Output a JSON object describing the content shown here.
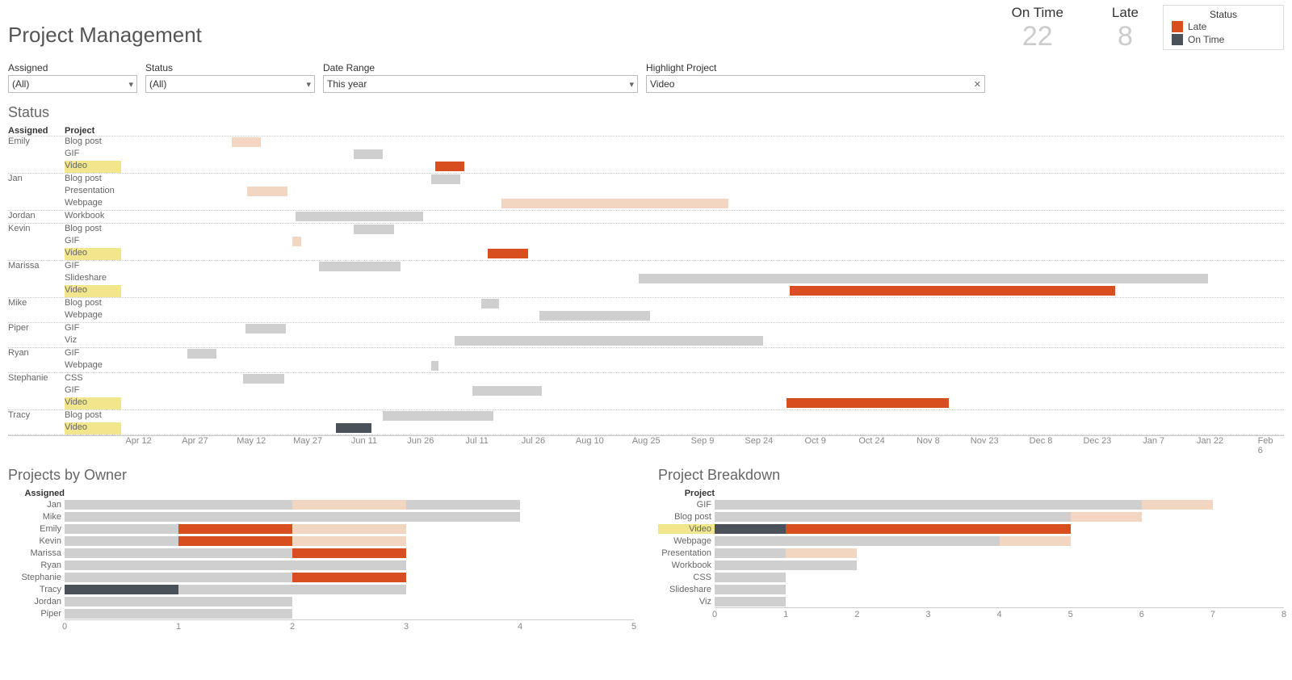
{
  "title": "Project Management",
  "kpi": {
    "on_time_label": "On Time",
    "on_time_value": "22",
    "late_label": "Late",
    "late_value": "8"
  },
  "legend": {
    "title": "Status",
    "late": "Late",
    "on_time": "On Time"
  },
  "filters": {
    "assigned": {
      "label": "Assigned",
      "value": "(All)"
    },
    "status": {
      "label": "Status",
      "value": "(All)"
    },
    "date": {
      "label": "Date Range",
      "value": "This year"
    },
    "highlight": {
      "label": "Highlight Project",
      "value": "Video"
    }
  },
  "status_section": {
    "title": "Status",
    "col_assigned": "Assigned",
    "col_project": "Project"
  },
  "owner_section": {
    "title": "Projects by Owner",
    "col": "Assigned"
  },
  "break_section": {
    "title": "Project Breakdown",
    "col": "Project"
  },
  "chart_data": {
    "gantt": {
      "type": "gantt",
      "x_start": "Apr 1",
      "x_end": "Feb 6",
      "ticks": [
        "Apr 12",
        "Apr 27",
        "May 12",
        "May 27",
        "Jun 11",
        "Jun 26",
        "Jul 11",
        "Jul 26",
        "Aug 10",
        "Aug 25",
        "Sep 9",
        "Sep 24",
        "Oct 9",
        "Oct 24",
        "Nov 8",
        "Nov 23",
        "Dec 8",
        "Dec 23",
        "Jan 7",
        "Jan 22",
        "Feb 6"
      ],
      "highlight_project": "Video",
      "groups": [
        {
          "assigned": "Emily",
          "rows": [
            {
              "project": "Blog post",
              "start_pct": 9.5,
              "width_pct": 2.5,
              "status": "late",
              "highlighted": false
            },
            {
              "project": "GIF",
              "start_pct": 20.0,
              "width_pct": 2.5,
              "status": "on_time",
              "highlighted": false
            },
            {
              "project": "Video",
              "start_pct": 27.0,
              "width_pct": 2.5,
              "status": "late",
              "highlighted": true
            }
          ]
        },
        {
          "assigned": "Jan",
          "rows": [
            {
              "project": "Blog post",
              "start_pct": 26.7,
              "width_pct": 2.5,
              "status": "on_time",
              "highlighted": false
            },
            {
              "project": "Presentation",
              "start_pct": 10.8,
              "width_pct": 3.5,
              "status": "late",
              "highlighted": false
            },
            {
              "project": "Webpage",
              "start_pct": 32.7,
              "width_pct": 19.5,
              "status": "late",
              "highlighted": false
            }
          ]
        },
        {
          "assigned": "Jordan",
          "rows": [
            {
              "project": "Workbook",
              "start_pct": 15.0,
              "width_pct": 11.0,
              "status": "on_time",
              "highlighted": false
            }
          ]
        },
        {
          "assigned": "Kevin",
          "rows": [
            {
              "project": "Blog post",
              "start_pct": 20.0,
              "width_pct": 3.5,
              "status": "on_time",
              "highlighted": false
            },
            {
              "project": "GIF",
              "start_pct": 14.7,
              "width_pct": 0.8,
              "status": "late",
              "highlighted": false
            },
            {
              "project": "Video",
              "start_pct": 31.5,
              "width_pct": 3.5,
              "status": "late",
              "highlighted": true
            }
          ]
        },
        {
          "assigned": "Marissa",
          "rows": [
            {
              "project": "GIF",
              "start_pct": 17.0,
              "width_pct": 7.0,
              "status": "on_time",
              "highlighted": false
            },
            {
              "project": "Slideshare",
              "start_pct": 44.5,
              "width_pct": 49.0,
              "status": "on_time",
              "highlighted": false
            },
            {
              "project": "Video",
              "start_pct": 57.5,
              "width_pct": 28.0,
              "status": "late",
              "highlighted": true
            }
          ]
        },
        {
          "assigned": "Mike",
          "rows": [
            {
              "project": "Blog post",
              "start_pct": 31.0,
              "width_pct": 1.5,
              "status": "on_time",
              "highlighted": false
            },
            {
              "project": "Webpage",
              "start_pct": 36.0,
              "width_pct": 9.5,
              "status": "on_time",
              "highlighted": false
            }
          ]
        },
        {
          "assigned": "Piper",
          "rows": [
            {
              "project": "GIF",
              "start_pct": 10.7,
              "width_pct": 3.5,
              "status": "on_time",
              "highlighted": false
            },
            {
              "project": "Viz",
              "start_pct": 28.7,
              "width_pct": 26.5,
              "status": "on_time",
              "highlighted": false
            }
          ]
        },
        {
          "assigned": "Ryan",
          "rows": [
            {
              "project": "GIF",
              "start_pct": 5.7,
              "width_pct": 2.5,
              "status": "on_time",
              "highlighted": false
            },
            {
              "project": "Webpage",
              "start_pct": 26.7,
              "width_pct": 0.6,
              "status": "on_time",
              "highlighted": false
            }
          ]
        },
        {
          "assigned": "Stephanie",
          "rows": [
            {
              "project": "CSS",
              "start_pct": 10.5,
              "width_pct": 3.5,
              "status": "on_time",
              "highlighted": false
            },
            {
              "project": "GIF",
              "start_pct": 30.2,
              "width_pct": 6.0,
              "status": "on_time",
              "highlighted": false
            },
            {
              "project": "Video",
              "start_pct": 57.2,
              "width_pct": 14.0,
              "status": "late",
              "highlighted": true
            }
          ]
        },
        {
          "assigned": "Tracy",
          "rows": [
            {
              "project": "Blog post",
              "start_pct": 22.5,
              "width_pct": 9.5,
              "status": "on_time",
              "highlighted": false
            },
            {
              "project": "Video",
              "start_pct": 18.5,
              "width_pct": 3.0,
              "status": "on_time",
              "highlighted": true
            }
          ]
        }
      ]
    },
    "projects_by_owner": {
      "type": "bar",
      "xmax": 5,
      "ticks": [
        0,
        1,
        2,
        3,
        4,
        5
      ],
      "rows": [
        {
          "label": "Jan",
          "segs": [
            {
              "v": 2,
              "k": "ot"
            },
            {
              "v": 1,
              "k": "lt"
            },
            {
              "v": 1,
              "k": "ot"
            }
          ]
        },
        {
          "label": "Mike",
          "segs": [
            {
              "v": 4,
              "k": "ot"
            }
          ]
        },
        {
          "label": "Emily",
          "segs": [
            {
              "v": 1,
              "k": "ot"
            },
            {
              "v": 1,
              "k": "lth"
            },
            {
              "v": 1,
              "k": "lt"
            }
          ]
        },
        {
          "label": "Kevin",
          "segs": [
            {
              "v": 1,
              "k": "ot"
            },
            {
              "v": 1,
              "k": "lth"
            },
            {
              "v": 1,
              "k": "lt"
            }
          ]
        },
        {
          "label": "Marissa",
          "segs": [
            {
              "v": 2,
              "k": "ot"
            },
            {
              "v": 1,
              "k": "lth"
            }
          ]
        },
        {
          "label": "Ryan",
          "segs": [
            {
              "v": 3,
              "k": "ot"
            }
          ]
        },
        {
          "label": "Stephanie",
          "segs": [
            {
              "v": 2,
              "k": "ot"
            },
            {
              "v": 1,
              "k": "lth"
            }
          ]
        },
        {
          "label": "Tracy",
          "segs": [
            {
              "v": 1,
              "k": "oth"
            },
            {
              "v": 2,
              "k": "ot"
            }
          ]
        },
        {
          "label": "Jordan",
          "segs": [
            {
              "v": 2,
              "k": "ot"
            }
          ]
        },
        {
          "label": "Piper",
          "segs": [
            {
              "v": 2,
              "k": "ot"
            }
          ]
        }
      ]
    },
    "project_breakdown": {
      "type": "bar",
      "xmax": 8,
      "ticks": [
        0,
        1,
        2,
        3,
        4,
        5,
        6,
        7,
        8
      ],
      "rows": [
        {
          "label": "GIF",
          "hl": false,
          "segs": [
            {
              "v": 6,
              "k": "ot"
            },
            {
              "v": 1,
              "k": "lt"
            }
          ]
        },
        {
          "label": "Blog post",
          "hl": false,
          "segs": [
            {
              "v": 5,
              "k": "ot"
            },
            {
              "v": 1,
              "k": "lt"
            }
          ]
        },
        {
          "label": "Video",
          "hl": true,
          "segs": [
            {
              "v": 1,
              "k": "oth"
            },
            {
              "v": 4,
              "k": "lth"
            }
          ]
        },
        {
          "label": "Webpage",
          "hl": false,
          "segs": [
            {
              "v": 4,
              "k": "ot"
            },
            {
              "v": 1,
              "k": "lt"
            }
          ]
        },
        {
          "label": "Presentation",
          "hl": false,
          "segs": [
            {
              "v": 1,
              "k": "ot"
            },
            {
              "v": 1,
              "k": "lt"
            }
          ]
        },
        {
          "label": "Workbook",
          "hl": false,
          "segs": [
            {
              "v": 2,
              "k": "ot"
            }
          ]
        },
        {
          "label": "CSS",
          "hl": false,
          "segs": [
            {
              "v": 1,
              "k": "ot"
            }
          ]
        },
        {
          "label": "Slideshare",
          "hl": false,
          "segs": [
            {
              "v": 1,
              "k": "ot"
            }
          ]
        },
        {
          "label": "Viz",
          "hl": false,
          "segs": [
            {
              "v": 1,
              "k": "ot"
            }
          ]
        }
      ]
    }
  }
}
